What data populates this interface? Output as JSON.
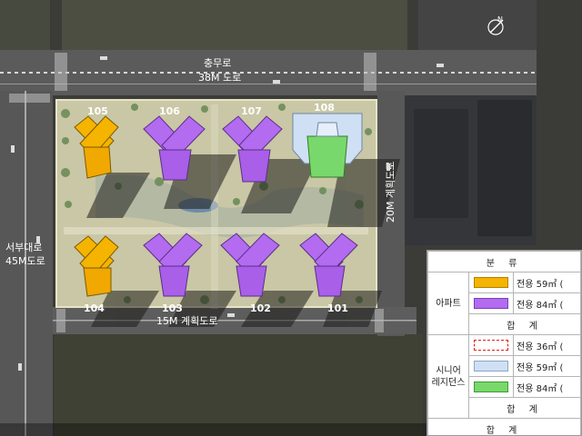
{
  "roads": {
    "north": {
      "line1": "충무로",
      "line2": "38M 도로"
    },
    "west": {
      "line1": "서부대로",
      "line2": "45M도로"
    },
    "south": "15M 계획도로",
    "east": "20M 계획도로"
  },
  "north_arrow": "N",
  "buildings": [
    "105",
    "106",
    "107",
    "108",
    "104",
    "103",
    "102",
    "101"
  ],
  "legend": {
    "header": "분 류",
    "groups": [
      {
        "label": "아파트",
        "rows": [
          {
            "text": "전용 59㎡ (",
            "color": "#f5b400",
            "border": "#b08000",
            "style": "solid"
          },
          {
            "text": "전용 84㎡ (",
            "color": "#b36bf0",
            "border": "#7a3fb8",
            "style": "solid"
          }
        ],
        "total": "합 계"
      },
      {
        "label_line1": "시니어",
        "label_line2": "레지던스",
        "rows": [
          {
            "text": "전용 36㎡ (",
            "color": "#ffffff",
            "border": "#e0201a",
            "style": "dashed"
          },
          {
            "text": "전용 59㎡ (",
            "color": "#cfe0f5",
            "border": "#8aa6c8",
            "style": "solid"
          },
          {
            "text": "전용 84㎡ (",
            "color": "#79d86b",
            "border": "#3f9a34",
            "style": "solid"
          }
        ],
        "total": "합 계"
      }
    ],
    "grand_total": "합 계"
  },
  "colors": {
    "apt59": "#f5b400",
    "apt84": "#b36bf0",
    "senior59": "#cfe0f5",
    "senior84": "#79d86b",
    "road": "#5a5a5a",
    "site": "#c9c7a5"
  }
}
